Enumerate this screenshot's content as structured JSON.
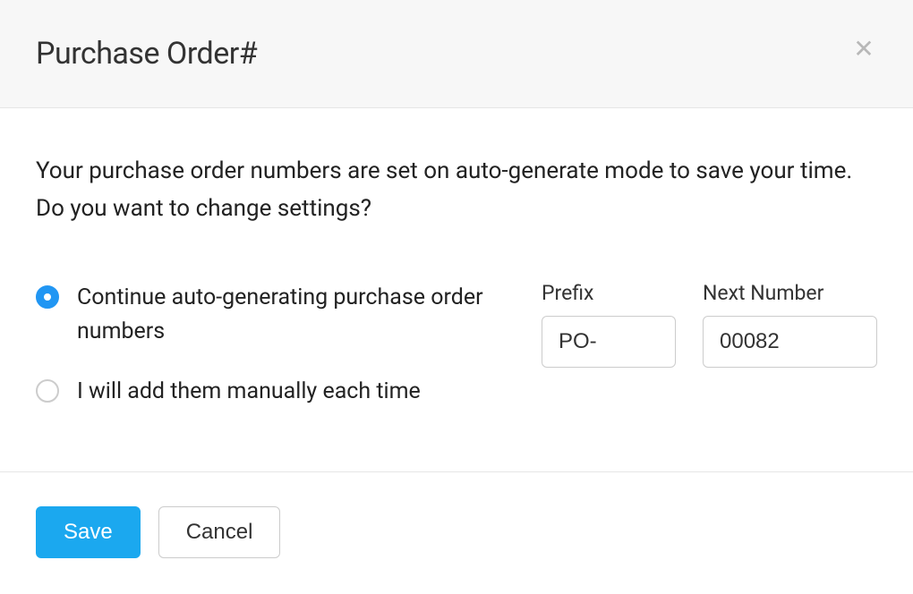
{
  "header": {
    "title": "Purchase Order#"
  },
  "body": {
    "description": "Your purchase order numbers are set on auto-generate mode to save your time. Do you want to change settings?",
    "options": {
      "auto": "Continue auto-generating purchase order numbers",
      "manual": "I will add them manually each time"
    },
    "fields": {
      "prefix_label": "Prefix",
      "prefix_value": "PO-",
      "next_number_label": "Next Number",
      "next_number_value": "00082"
    }
  },
  "footer": {
    "save": "Save",
    "cancel": "Cancel"
  }
}
